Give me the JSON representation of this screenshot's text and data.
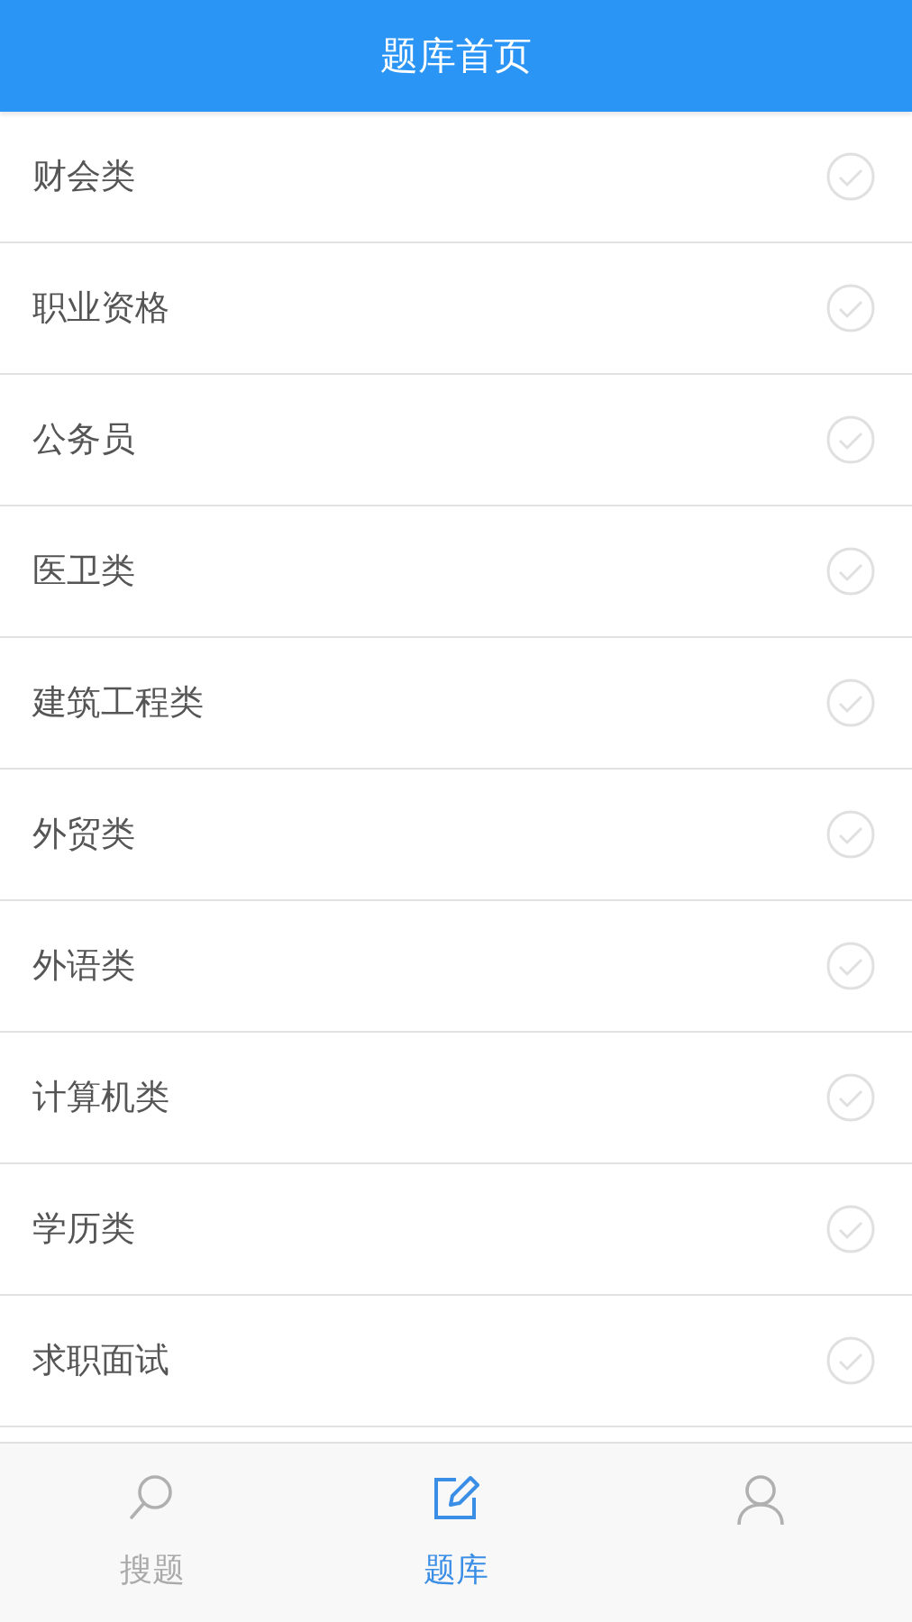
{
  "header": {
    "title": "题库首页"
  },
  "categories": [
    {
      "label": "财会类"
    },
    {
      "label": "职业资格"
    },
    {
      "label": "公务员"
    },
    {
      "label": "医卫类"
    },
    {
      "label": "建筑工程类"
    },
    {
      "label": "外贸类"
    },
    {
      "label": "外语类"
    },
    {
      "label": "计算机类"
    },
    {
      "label": "学历类"
    },
    {
      "label": "求职面试"
    }
  ],
  "tabs": [
    {
      "kind": "search",
      "label": "搜题",
      "selected": false
    },
    {
      "kind": "edit",
      "label": "题库",
      "selected": true
    },
    {
      "kind": "person",
      "selected": false
    }
  ]
}
